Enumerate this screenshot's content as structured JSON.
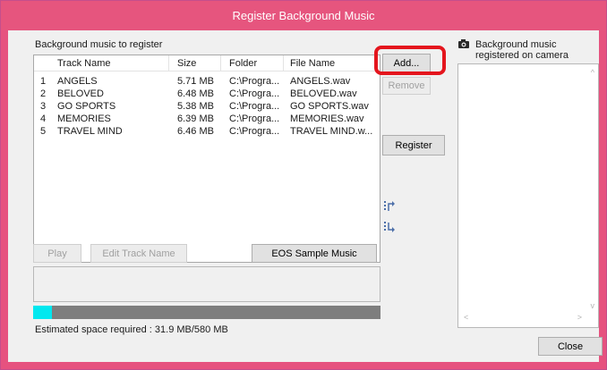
{
  "window": {
    "title": "Register Background Music",
    "accent_color": "#e6557e"
  },
  "left_panel": {
    "section_label": "Background music to register",
    "columns": [
      "Track Name",
      "Size",
      "Folder",
      "File Name"
    ],
    "rows": [
      {
        "num": "1",
        "name": "ANGELS",
        "size": "5.71 MB",
        "folder": "C:\\Progra...",
        "file": "ANGELS.wav"
      },
      {
        "num": "2",
        "name": "BELOVED",
        "size": "6.48 MB",
        "folder": "C:\\Progra...",
        "file": "BELOVED.wav"
      },
      {
        "num": "3",
        "name": "GO SPORTS",
        "size": "5.38 MB",
        "folder": "C:\\Progra...",
        "file": "GO SPORTS.wav"
      },
      {
        "num": "4",
        "name": "MEMORIES",
        "size": "6.39 MB",
        "folder": "C:\\Progra...",
        "file": "MEMORIES.wav"
      },
      {
        "num": "5",
        "name": "TRAVEL MIND",
        "size": "6.46 MB",
        "folder": "C:\\Progra...",
        "file": "TRAVEL MIND.w..."
      }
    ],
    "play_label": "Play",
    "edit_track_name_label": "Edit Track Name",
    "eos_sample_music_label": "EOS Sample Music",
    "progress_fraction": 0.055,
    "estimated_space": "Estimated space required : 31.9 MB/580 MB"
  },
  "middle": {
    "add_label": "Add...",
    "remove_label": "Remove",
    "register_label": "Register",
    "icons": [
      "move-up-icon",
      "move-down-icon"
    ]
  },
  "right_panel": {
    "label_line1": "Background music",
    "label_line2": "registered on camera",
    "icon": "camera-icon"
  },
  "footer": {
    "close_label": "Close"
  }
}
